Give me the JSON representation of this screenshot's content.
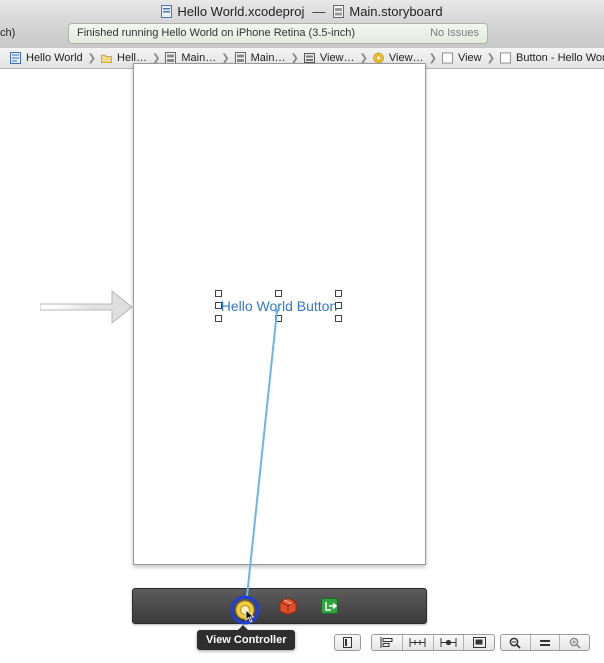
{
  "window": {
    "project_name": "Hello World.xcodeproj",
    "separator": "—",
    "file_name": "Main.storyboard"
  },
  "toolbar": {
    "scheme_clipped": "ch)",
    "activity_status": "Finished running Hello World on iPhone Retina (3.5-inch)",
    "issues_label": "No Issues"
  },
  "jumpbar": {
    "crumbs": [
      {
        "label": "Hello World",
        "icon": "project-icon"
      },
      {
        "label": "Hell…",
        "icon": "folder-icon"
      },
      {
        "label": "Main…",
        "icon": "storyboard-file-icon"
      },
      {
        "label": "Main…",
        "icon": "storyboard-file-icon"
      },
      {
        "label": "View…",
        "icon": "scene-icon"
      },
      {
        "label": "View…",
        "icon": "view-controller-icon"
      },
      {
        "label": "View",
        "icon": "view-icon"
      },
      {
        "label": "Button - Hello World Butt",
        "icon": "button-icon"
      }
    ]
  },
  "canvas": {
    "button_title": "Hello World Button",
    "dock": {
      "icons": [
        "view-controller-icon",
        "first-responder-icon",
        "exit-icon"
      ]
    },
    "tooltip": "View Controller"
  },
  "colors": {
    "button_text": "#3477c6",
    "connection_line": "#6bb4ee",
    "dock_highlight": "#1f3fd6"
  }
}
